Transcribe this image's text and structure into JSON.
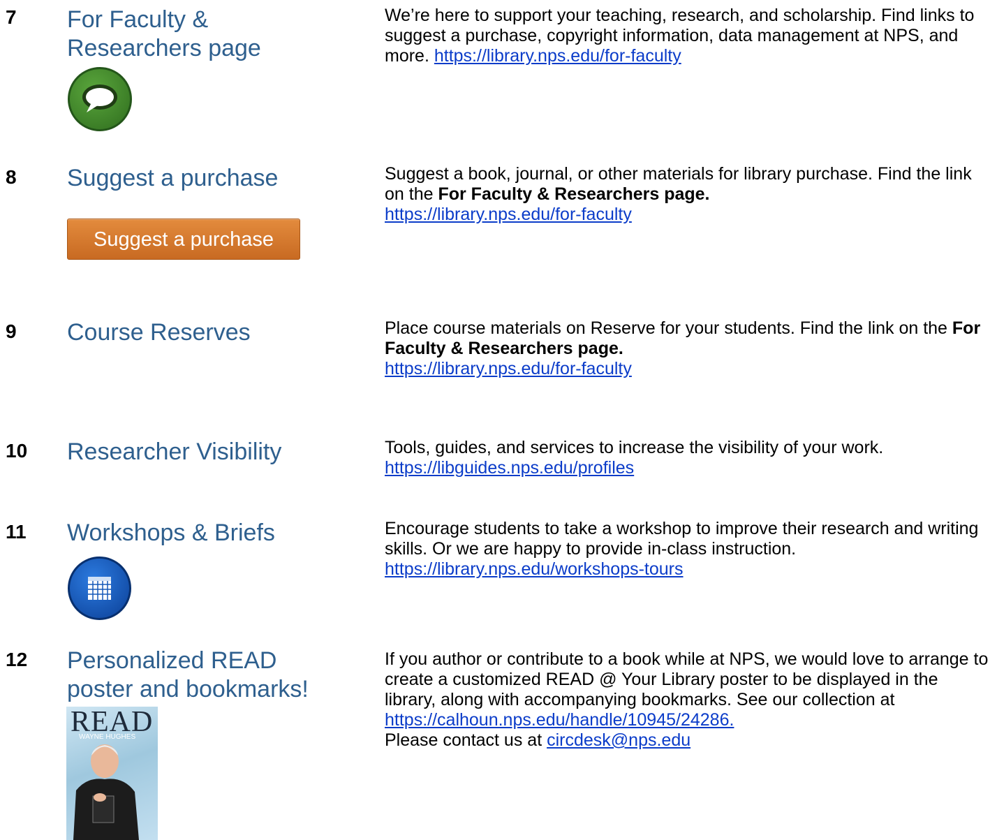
{
  "items": [
    {
      "num": "7",
      "title": "For Faculty & Researchers page",
      "desc_parts": [
        "We’re here to support your teaching, research, and scholarship. Find links to suggest a purchase, copyright information, data management at NPS, and more. "
      ],
      "link": "https://library.nps.edu/for-faculty",
      "icon": "speech-bubble-icon"
    },
    {
      "num": "8",
      "title": "Suggest a purchase",
      "desc_text": "Suggest a book, journal, or other materials for library purchase. Find the link on the ",
      "desc_bold": "For Faculty & Researchers page.",
      "link": "https://library.nps.edu/for-faculty",
      "button_label": "Suggest a purchase"
    },
    {
      "num": "9",
      "title": "Course Reserves",
      "desc_text": "Place course materials on Reserve for your students. Find the link on the ",
      "desc_bold": "For Faculty & Researchers page.",
      "link": "https://library.nps.edu/for-faculty"
    },
    {
      "num": "10",
      "title": "Researcher Visibility",
      "desc_text": "Tools, guides, and services to increase the visibility of your work.",
      "link": "https://libguides.nps.edu/profiles"
    },
    {
      "num": "11",
      "title": "Workshops & Briefs",
      "desc_text": "Encourage students to take a workshop to improve their research and writing skills. Or we are happy to provide in-class instruction.",
      "link": "https://library.nps.edu/workshops-tours",
      "icon": "calendar-icon"
    },
    {
      "num": "12",
      "title": "Personalized READ poster and bookmarks!",
      "desc_text": "If you author or contribute to a book while at NPS, we would love to arrange to create a customized READ @ Your Library poster to be displayed in the library, along with accompanying bookmarks. See our collection at ",
      "link": "https://calhoun.nps.edu/handle/10945/24286.",
      "desc_text2": "Please contact us at ",
      "email": "circdesk@nps.edu",
      "poster": {
        "heading": "READ",
        "name": "WAYNE HUGHES"
      }
    }
  ],
  "colors": {
    "title": "#2e5f8e",
    "link": "#0b3cc9",
    "green": "#3f8a2a",
    "blue": "#1558b8",
    "orange": "#d67a2c"
  }
}
